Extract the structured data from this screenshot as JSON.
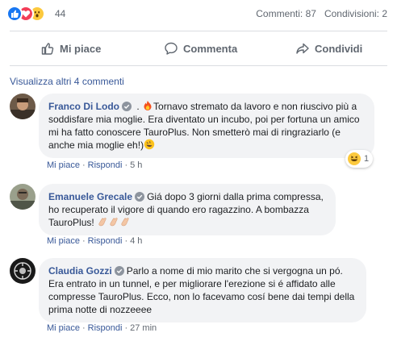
{
  "reactions": {
    "count": "44",
    "types": [
      "like-icon",
      "love-icon",
      "wow-icon"
    ],
    "colors": {
      "like": "#1877f2",
      "love": "#f33e58",
      "wow": "#fcc93d"
    }
  },
  "stats": {
    "comments": "Commenti: 87",
    "shares": "Condivisioni: 2"
  },
  "actions": {
    "like": "Mi piace",
    "comment": "Commenta",
    "share": "Condividi"
  },
  "view_more": "Visualizza altri 4 commenti",
  "comments": [
    {
      "author": "Franco Di Lodo",
      "text_lead": " .",
      "text": "Tornavo stremato da lavoro e non riuscivo più a soddisfare mia moglie. Era diventato un incubo, poi per fortuna un amico mi ha fatto conoscere TauroPlus. Non smetterò mai di ringraziarlo (e anche mia moglie eh!)",
      "like": "Mi piace",
      "reply": "Rispondi",
      "time": "5 h",
      "reaction_count": "1"
    },
    {
      "author": "Emanuele Grecale",
      "text": "Giá dopo 3 giorni dalla prima compressa, ho recuperato il vigore di quando ero ragazzino. A bombazza TauroPlus!",
      "like": "Mi piace",
      "reply": "Rispondi",
      "time": "4 h"
    },
    {
      "author": "Claudia Gozzi",
      "text": "Parlo a nome di mio marito che si vergogna un pó. Era entrato in un tunnel, e per migliorare l'erezione si é affidato alle compresse TauroPlus. Ecco, non lo facevamo cosí bene dai tempi della prima notte di nozzeeee",
      "like": "Mi piace",
      "reply": "Rispondi",
      "time": "27 min"
    }
  ]
}
